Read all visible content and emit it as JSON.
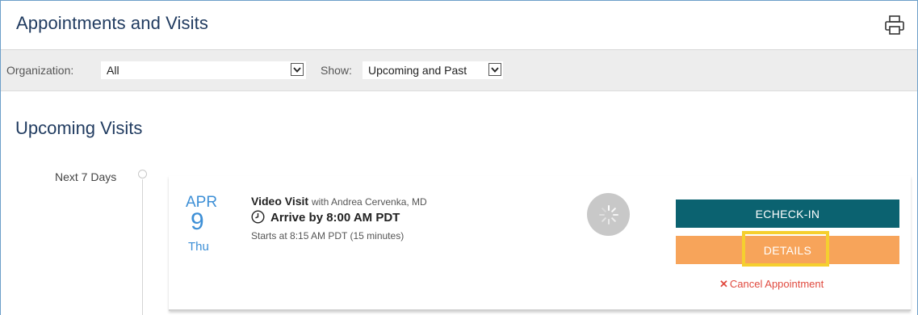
{
  "header": {
    "title": "Appointments and Visits",
    "print_icon": "printer-icon"
  },
  "filters": {
    "organization_label": "Organization:",
    "organization_value": "All",
    "show_label": "Show:",
    "show_value": "Upcoming and Past"
  },
  "upcoming": {
    "section_title": "Upcoming Visits",
    "range_label": "Next 7 Days"
  },
  "appointment": {
    "month": "APR",
    "day": "9",
    "weekday": "Thu",
    "visit_type": "Video Visit",
    "with_text": "with Andrea Cervenka, MD",
    "arrive_text": "Arrive by 8:00 AM PDT",
    "starts_text": "Starts at 8:15 AM PDT (15 minutes)",
    "echeckin_label": "ECHECK-IN",
    "details_label": "DETAILS",
    "cancel_label": "Cancel Appointment"
  },
  "colors": {
    "title": "#1f3a5f",
    "date_accent": "#3d8fd6",
    "echeckin_bg": "#0b6270",
    "details_bg": "#f7a45a",
    "highlight": "#f5cf2f",
    "cancel": "#e04a3f"
  }
}
